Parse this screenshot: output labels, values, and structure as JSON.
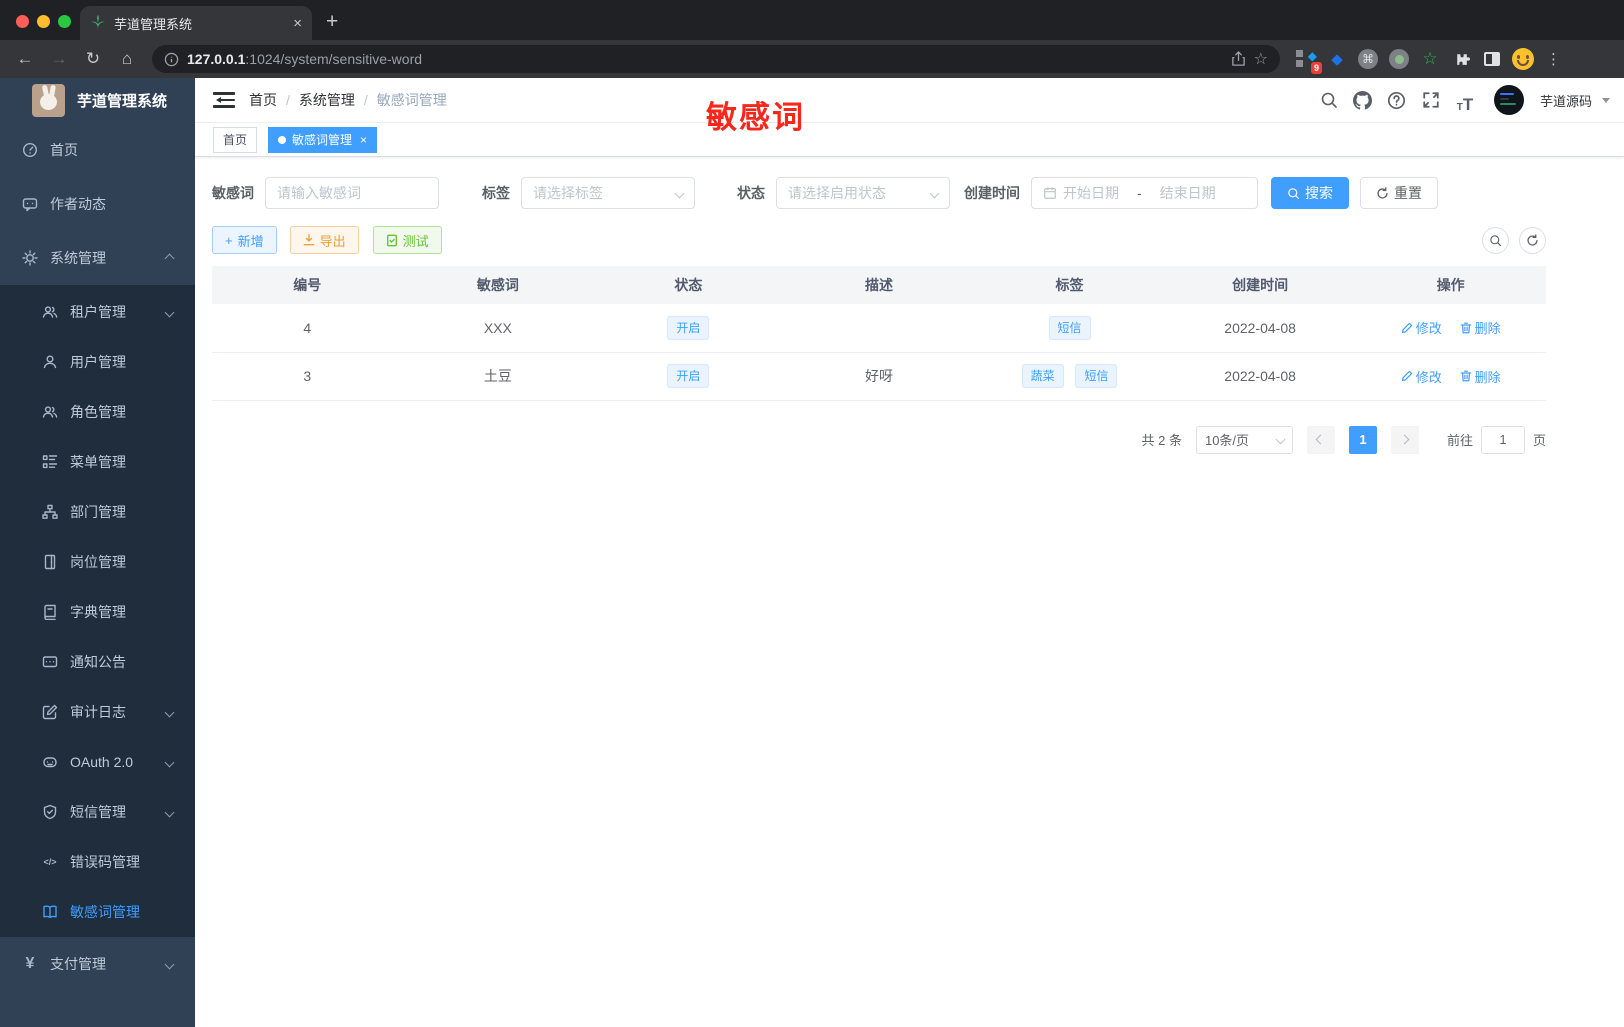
{
  "colors": {
    "accent": "#409eff",
    "sidebar_bg": "#304156",
    "submenu_bg": "#1f2d3d",
    "annotation_red": "#f6281c"
  },
  "browser": {
    "tab_title": "芋道管理系统",
    "close_tab": "×",
    "new_tab": "+",
    "url_host": "127.0.0.1",
    "url_rest": ":1024/system/sensitive-word",
    "extension_badge": "9",
    "cmd_glyph": "⌘",
    "star_glyph": "☆",
    "green_star_glyph": "☆",
    "diamond_glyph": "◆",
    "kebab_glyph": "⋮"
  },
  "annotation": {
    "text": "敏感词"
  },
  "sidebar": {
    "title": "芋道管理系统",
    "menu": [
      {
        "label": "首页"
      },
      {
        "label": "作者动态"
      },
      {
        "label": "系统管理"
      },
      {
        "label": "租户管理"
      },
      {
        "label": "用户管理"
      },
      {
        "label": "角色管理"
      },
      {
        "label": "菜单管理"
      },
      {
        "label": "部门管理"
      },
      {
        "label": "岗位管理"
      },
      {
        "label": "字典管理"
      },
      {
        "label": "通知公告"
      },
      {
        "label": "审计日志"
      },
      {
        "label": "OAuth 2.0"
      },
      {
        "label": "短信管理"
      },
      {
        "label": "错误码管理"
      },
      {
        "label": "敏感词管理"
      },
      {
        "label": "支付管理"
      }
    ],
    "code_glyph": "</>",
    "yen_glyph": "¥"
  },
  "header": {
    "breadcrumb": [
      "首页",
      "系统管理",
      "敏感词管理"
    ],
    "separator": "/",
    "username": "芋道源码"
  },
  "tags_view": {
    "tabs": [
      {
        "label": "首页"
      },
      {
        "label": "敏感词管理"
      }
    ],
    "close_glyph": "×"
  },
  "filters": {
    "keyword_label": "敏感词",
    "keyword_placeholder": "请输入敏感词",
    "tag_label": "标签",
    "tag_placeholder": "请选择标签",
    "status_label": "状态",
    "status_placeholder": "请选择启用状态",
    "date_label": "创建时间",
    "date_start": "开始日期",
    "date_sep": "-",
    "date_end": "结束日期",
    "search": "搜索",
    "reset": "重置"
  },
  "toolbar": {
    "add": "新增",
    "export": "导出",
    "test": "测试"
  },
  "table": {
    "columns": [
      "编号",
      "敏感词",
      "状态",
      "描述",
      "标签",
      "创建时间",
      "操作"
    ],
    "rows": [
      {
        "id": "4",
        "word": "XXX",
        "status": "开启",
        "description": "",
        "tags": [
          "短信"
        ],
        "created": "2022-04-08"
      },
      {
        "id": "3",
        "word": "土豆",
        "status": "开启",
        "description": "好呀",
        "tags": [
          "蔬菜",
          "短信"
        ],
        "created": "2022-04-08"
      }
    ],
    "edit": "修改",
    "delete": "删除"
  },
  "pagination": {
    "total": "共 2 条",
    "page_size": "10条/页",
    "page": "1",
    "goto": "前往",
    "goto_value": "1",
    "unit": "页"
  }
}
